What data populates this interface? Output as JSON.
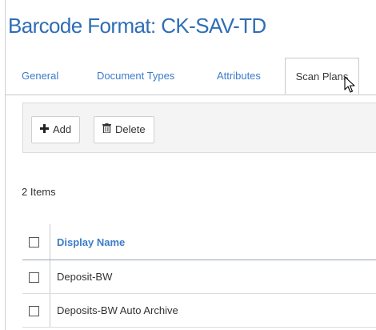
{
  "page": {
    "title": "Barcode Format: CK-SAV-TD"
  },
  "tabs": [
    {
      "label": "General",
      "active": false
    },
    {
      "label": "Document Types",
      "active": false
    },
    {
      "label": "Attributes",
      "active": false
    },
    {
      "label": "Scan Plans",
      "active": true
    }
  ],
  "toolbar": {
    "add_label": "Add",
    "add_icon": "plus-icon",
    "delete_label": "Delete",
    "delete_icon": "trash-icon"
  },
  "grid": {
    "count_label": "2 Items",
    "columns": [
      "Display Name"
    ],
    "rows": [
      {
        "display_name": "Deposit-BW",
        "checked": false
      },
      {
        "display_name": "Deposits-BW Auto Archive",
        "checked": false
      }
    ]
  },
  "colors": {
    "accent": "#2f6db5",
    "link": "#3d7cc9",
    "toolbar_bg": "#f4f4f4"
  }
}
